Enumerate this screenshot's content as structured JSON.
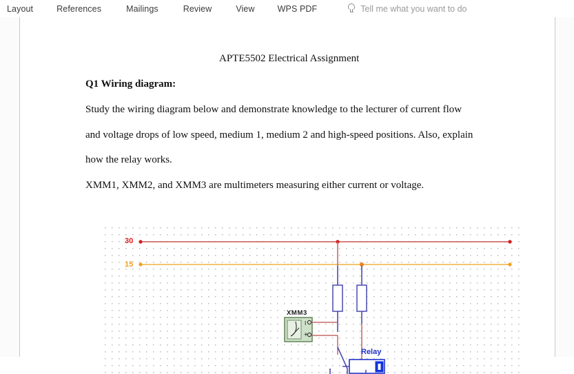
{
  "ribbon": {
    "tabs": [
      {
        "id": "layout",
        "label": "Layout"
      },
      {
        "id": "references",
        "label": "References"
      },
      {
        "id": "mailings",
        "label": "Mailings"
      },
      {
        "id": "review",
        "label": "Review"
      },
      {
        "id": "view",
        "label": "View"
      },
      {
        "id": "wpspdf",
        "label": "WPS PDF"
      }
    ],
    "tell_me": {
      "icon": "lightbulb-icon",
      "label": "Tell me what you want to do"
    }
  },
  "document": {
    "title": "APTE5502 Electrical Assignment",
    "heading": "Q1 Wiring diagram:",
    "paragraphs": [
      "Study the wiring diagram below and demonstrate knowledge to the lecturer of current flow",
      "and voltage drops of low speed, medium 1, medium 2 and high-speed positions. Also, explain",
      "how the relay works.",
      "XMM1, XMM2, and XMM3 are multimeters measuring either current or voltage."
    ]
  },
  "diagram": {
    "labels": {
      "rail_30": "30",
      "rail_15": "15",
      "multimeter": "XMM3",
      "relay": "Relay",
      "terminal_i": "I",
      "terminal_plus": "+"
    },
    "colors": {
      "rail_30": "#cc3333",
      "rail_15": "#f0a830",
      "wire_blue": "#4a4ab0",
      "wire_red": "#c46a6a",
      "relay_blue": "#2233cc",
      "meter_fill": "#cfe0c8",
      "meter_border": "#6a8a62",
      "grid_dot": "#b9b9b9"
    }
  }
}
